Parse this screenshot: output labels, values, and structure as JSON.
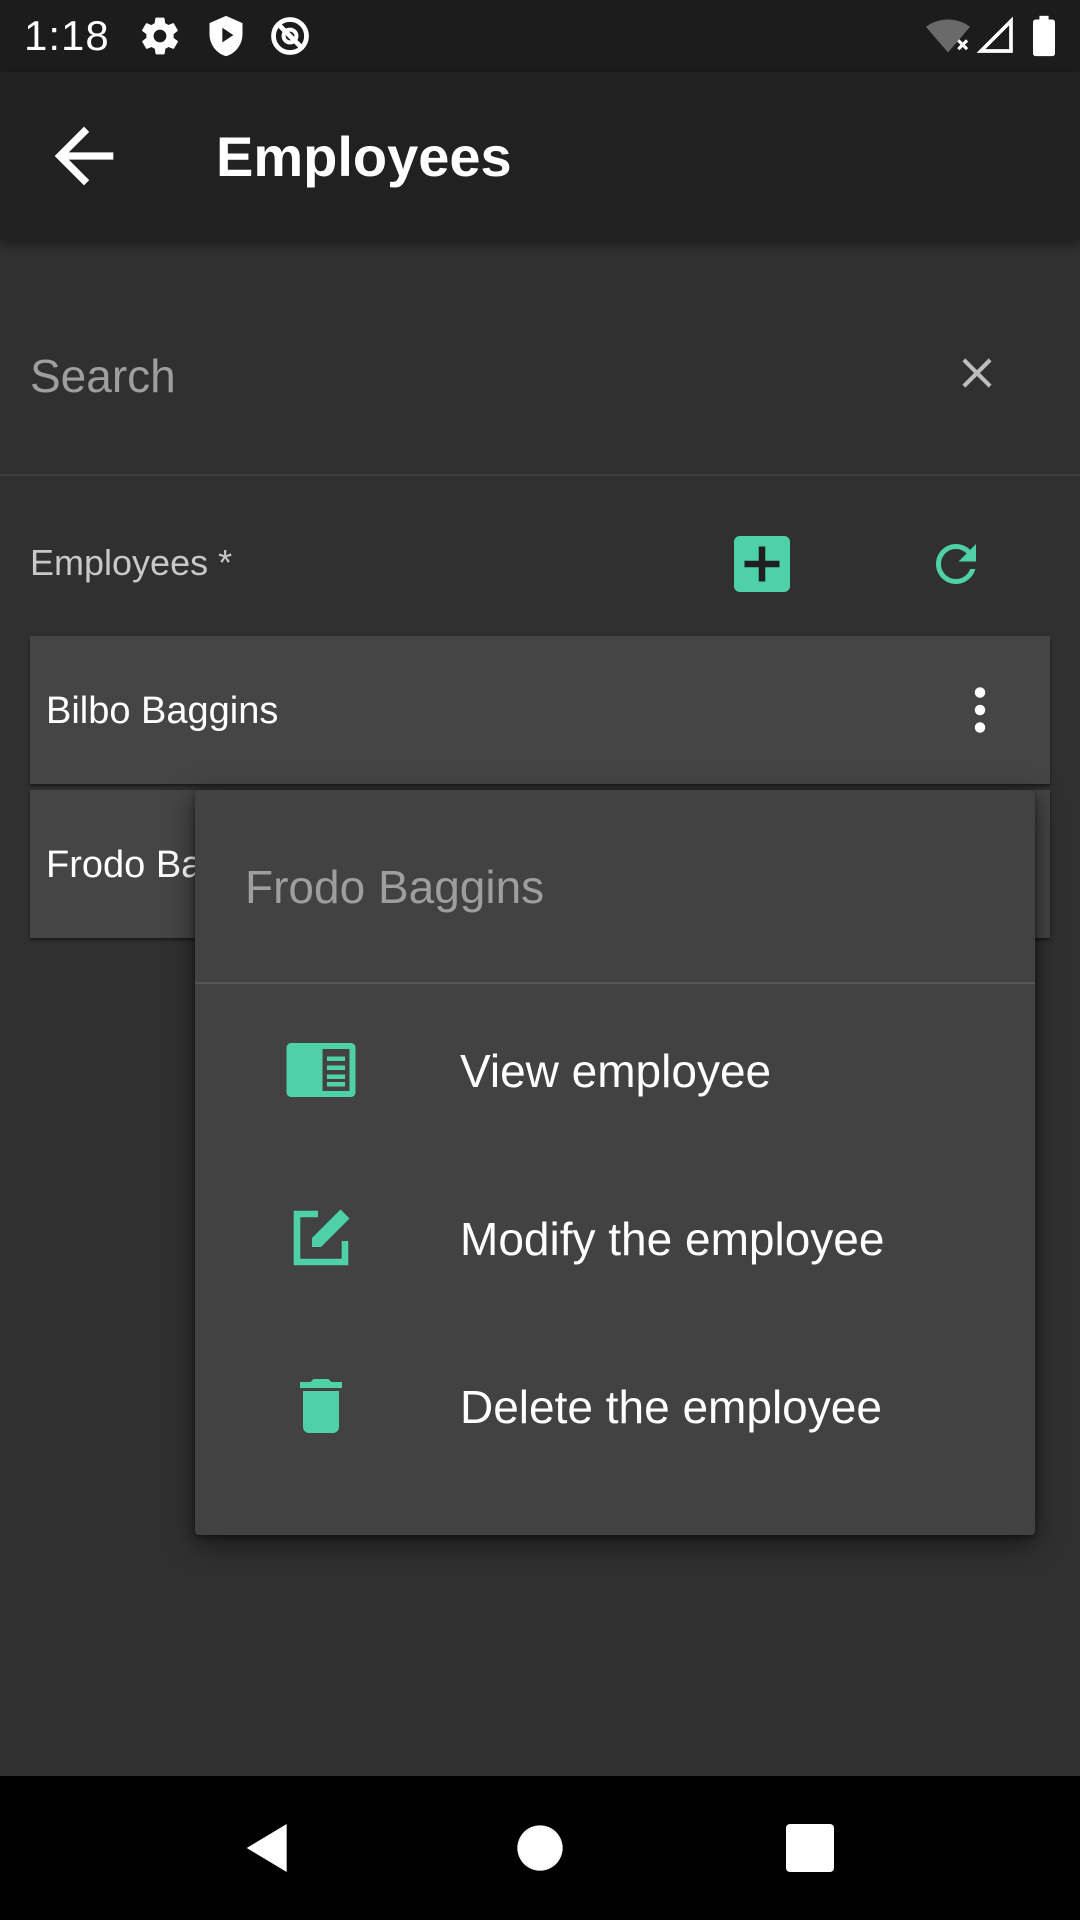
{
  "status_bar": {
    "time": "1:18",
    "icons": [
      "gear-icon",
      "shield-play-icon",
      "data-saver-icon",
      "wifi-off-icon",
      "signal-icon",
      "battery-icon"
    ]
  },
  "app_bar": {
    "title": "Employees",
    "back_icon": "arrow-left-icon"
  },
  "search": {
    "placeholder": "Search",
    "value": "",
    "clear_icon": "close-icon"
  },
  "list": {
    "label": "Employees *",
    "add_icon": "plus-box-icon",
    "refresh_icon": "refresh-icon",
    "items": [
      {
        "name": "Bilbo Baggins"
      },
      {
        "name": "Frodo Baggins"
      }
    ]
  },
  "context_menu": {
    "title": "Frodo Baggins",
    "items": [
      {
        "label": "View employee",
        "icon": "card-details-icon"
      },
      {
        "label": "Modify the employee",
        "icon": "edit-box-icon"
      },
      {
        "label": "Delete the employee",
        "icon": "trash-icon"
      }
    ]
  },
  "nav_bar": {
    "icons": [
      "back-triangle-icon",
      "home-circle-icon",
      "recents-square-icon"
    ]
  },
  "colors": {
    "accent": "#4fd1a8",
    "background": "#303030",
    "app_bar": "#212121",
    "row": "#454545",
    "menu": "#424242"
  }
}
